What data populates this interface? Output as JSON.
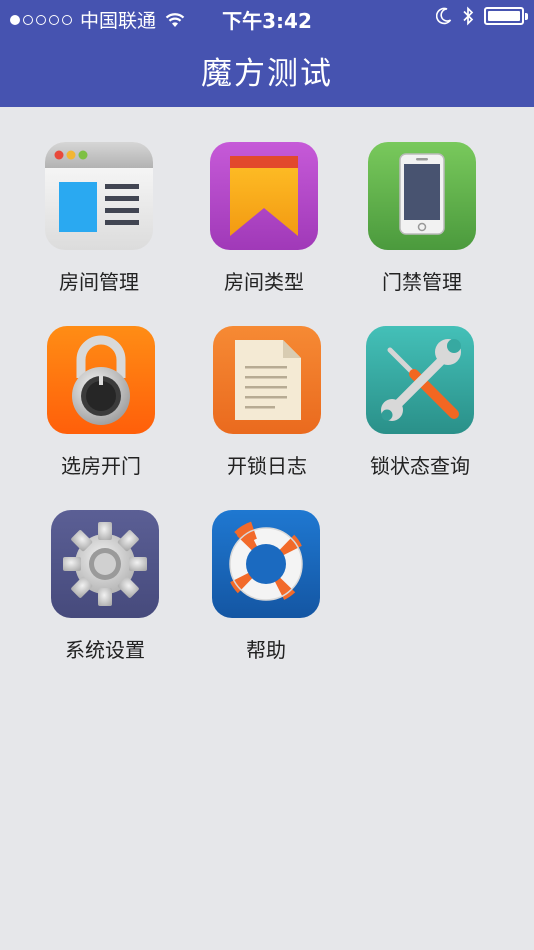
{
  "status_bar": {
    "carrier": "中国联通",
    "time": "下午3:42",
    "signal_filled": 1,
    "signal_total": 5,
    "battery_level": 0.95,
    "icons": [
      "wifi-icon",
      "moon-icon",
      "bluetooth-icon",
      "battery-icon"
    ]
  },
  "header": {
    "title": "魔方测试",
    "background": "#4653b0"
  },
  "menu": [
    {
      "label": "房间管理",
      "icon": "browser-window-icon"
    },
    {
      "label": "房间类型",
      "icon": "bookmark-icon"
    },
    {
      "label": "门禁管理",
      "icon": "phone-icon"
    },
    {
      "label": "选房开门",
      "icon": "padlock-icon"
    },
    {
      "label": "开锁日志",
      "icon": "document-icon"
    },
    {
      "label": "锁状态查询",
      "icon": "tools-icon"
    },
    {
      "label": "系统设置",
      "icon": "gear-icon"
    },
    {
      "label": "帮助",
      "icon": "lifebuoy-icon"
    }
  ]
}
